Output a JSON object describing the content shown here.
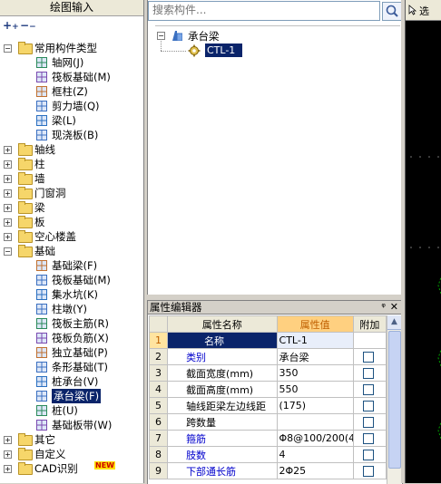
{
  "left_panel": {
    "title": "绘图输入",
    "tree": [
      {
        "level": 0,
        "exp": "-",
        "type": "folder",
        "label": "常用构件类型"
      },
      {
        "level": 1,
        "type": "grid-icon",
        "label": "轴网(J)"
      },
      {
        "level": 1,
        "type": "raft-icon",
        "label": "筏板基础(M)"
      },
      {
        "level": 1,
        "type": "column-icon",
        "label": "框柱(Z)"
      },
      {
        "level": 1,
        "type": "shear-wall-icon",
        "label": "剪力墙(Q)"
      },
      {
        "level": 1,
        "type": "beam-icon",
        "label": "梁(L)"
      },
      {
        "level": 1,
        "type": "slab-icon",
        "label": "现浇板(B)"
      },
      {
        "level": 0,
        "exp": "+",
        "type": "folder",
        "label": "轴线"
      },
      {
        "level": 0,
        "exp": "+",
        "type": "folder",
        "label": "柱"
      },
      {
        "level": 0,
        "exp": "+",
        "type": "folder",
        "label": "墙"
      },
      {
        "level": 0,
        "exp": "+",
        "type": "folder",
        "label": "门窗洞"
      },
      {
        "level": 0,
        "exp": "+",
        "type": "folder",
        "label": "梁"
      },
      {
        "level": 0,
        "exp": "+",
        "type": "folder",
        "label": "板"
      },
      {
        "level": 0,
        "exp": "+",
        "type": "folder",
        "label": "空心楼盖"
      },
      {
        "level": 0,
        "exp": "-",
        "type": "folder",
        "label": "基础"
      },
      {
        "level": 1,
        "type": "foundation-beam-icon",
        "label": "基础梁(F)"
      },
      {
        "level": 1,
        "type": "raft-icon",
        "label": "筏板基础(M)"
      },
      {
        "level": 1,
        "type": "sump-icon",
        "label": "集水坑(K)"
      },
      {
        "level": 1,
        "type": "column-pier-icon",
        "label": "柱墩(Y)"
      },
      {
        "level": 1,
        "type": "raft-main-rebar-icon",
        "label": "筏板主筋(R)"
      },
      {
        "level": 1,
        "type": "raft-neg-rebar-icon",
        "label": "筏板负筋(X)"
      },
      {
        "level": 1,
        "type": "isolated-footing-icon",
        "label": "独立基础(P)"
      },
      {
        "level": 1,
        "type": "strip-footing-icon",
        "label": "条形基础(T)"
      },
      {
        "level": 1,
        "type": "pile-cap-icon",
        "label": "桩承台(V)"
      },
      {
        "level": 1,
        "type": "cap-beam-icon",
        "label": "承台梁(F)",
        "selected": true
      },
      {
        "level": 1,
        "type": "pile-icon",
        "label": "桩(U)"
      },
      {
        "level": 1,
        "type": "foundation-band-icon",
        "label": "基础板带(W)"
      },
      {
        "level": 0,
        "exp": "+",
        "type": "folder",
        "label": "其它"
      },
      {
        "level": 0,
        "exp": "+",
        "type": "folder",
        "label": "自定义"
      },
      {
        "level": 0,
        "exp": "+",
        "type": "folder",
        "label": "CAD识别",
        "badge": "NEW"
      }
    ]
  },
  "component_panel": {
    "search_placeholder": "搜索构件...",
    "root_label": "承台梁",
    "child_label": "CTL-1"
  },
  "property_editor": {
    "title": "属性编辑器",
    "headers": {
      "name": "属性名称",
      "value": "属性值",
      "extra": "附加"
    },
    "rows": [
      {
        "num": "1",
        "name": "名称",
        "value": "CTL-1",
        "blue": true,
        "checkbox": false
      },
      {
        "num": "2",
        "name": "类别",
        "value": "承台梁",
        "blue": true,
        "checkbox": true
      },
      {
        "num": "3",
        "name": "截面宽度(mm)",
        "value": "350",
        "blue": false,
        "checkbox": true
      },
      {
        "num": "4",
        "name": "截面高度(mm)",
        "value": "550",
        "blue": false,
        "checkbox": true
      },
      {
        "num": "5",
        "name": "轴线距梁左边线距",
        "value": "(175)",
        "blue": false,
        "checkbox": true
      },
      {
        "num": "6",
        "name": "跨数量",
        "value": "",
        "blue": false,
        "checkbox": true
      },
      {
        "num": "7",
        "name": "箍筋",
        "value": "Φ8@100/200(4",
        "blue": true,
        "checkbox": true
      },
      {
        "num": "8",
        "name": "肢数",
        "value": "4",
        "blue": true,
        "checkbox": true
      },
      {
        "num": "9",
        "name": "下部通长筋",
        "value": "2Φ25",
        "blue": true,
        "checkbox": true
      }
    ]
  },
  "canvas": {
    "toolbar_label": "选"
  }
}
